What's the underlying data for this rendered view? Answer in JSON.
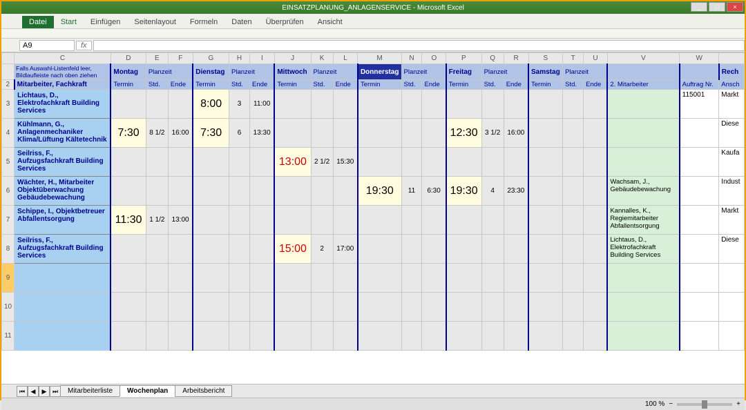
{
  "window": {
    "title": "EINSATZPLANUNG_ANLAGENSERVICE - Microsoft Excel",
    "min": "_",
    "max": "□",
    "close": "×"
  },
  "ribbon": {
    "tabs": [
      "Datei",
      "Start",
      "Einfügen",
      "Seitenlayout",
      "Formeln",
      "Daten",
      "Überprüfen",
      "Ansicht"
    ]
  },
  "formula": {
    "name_box": "A9",
    "fx": "fx"
  },
  "cols": [
    "C",
    "D",
    "E",
    "F",
    "G",
    "H",
    "I",
    "J",
    "K",
    "L",
    "M",
    "N",
    "O",
    "P",
    "Q",
    "R",
    "S",
    "T",
    "U",
    "V",
    "W"
  ],
  "row_nums": [
    "2",
    "3",
    "4",
    "5",
    "6",
    "7",
    "8",
    "9",
    "10",
    "11"
  ],
  "note": "Falls Auswahl-Listenfeld leer, Bildlaufleiste nach oben ziehen",
  "days": [
    "Montag",
    "Dienstag",
    "Mittwoch",
    "Donnerstag",
    "Freitag",
    "Samstag"
  ],
  "planzeit": "Planzeit",
  "subhdr": {
    "mit": "Mitarbeiter, Fachkraft",
    "termin": "Termin",
    "std": "Std.",
    "ende": "Ende",
    "mit2": "2. Mitarbeiter",
    "auftrag": "Auftrag Nr.",
    "ansch": "Ansch",
    "rech": "Rech"
  },
  "rows": [
    {
      "emp": "Lichtaus, D., Elektrofachkraft Building Services",
      "mo": {
        "t": "",
        "s": "",
        "e": ""
      },
      "di": {
        "t": "8:00",
        "s": "3",
        "e": "11:00"
      },
      "mi": {
        "t": "",
        "s": "",
        "e": ""
      },
      "do": {
        "t": "",
        "s": "",
        "e": ""
      },
      "fr": {
        "t": "",
        "s": "",
        "e": ""
      },
      "sa": {
        "t": "",
        "s": "",
        "e": ""
      },
      "mit2": "",
      "auftrag": "115001",
      "an": "Markt"
    },
    {
      "emp": "Kühlmann, G., Anlagenmechaniker Klima/Lüftung Kältetechnik",
      "mo": {
        "t": "7:30",
        "s": "8 1/2",
        "e": "16:00"
      },
      "di": {
        "t": "7:30",
        "s": "6",
        "e": "13:30"
      },
      "mi": {
        "t": "",
        "s": "",
        "e": ""
      },
      "do": {
        "t": "",
        "s": "",
        "e": ""
      },
      "fr": {
        "t": "12:30",
        "s": "3 1/2",
        "e": "16:00"
      },
      "sa": {
        "t": "",
        "s": "",
        "e": ""
      },
      "mit2": "",
      "auftrag": "",
      "an": "Diese"
    },
    {
      "emp": "Seilriss, F., Aufzugsfachkraft Building Services",
      "mo": {
        "t": "",
        "s": "",
        "e": ""
      },
      "di": {
        "t": "",
        "s": "",
        "e": ""
      },
      "mi": {
        "t": "13:00",
        "s": "2 1/2",
        "e": "15:30",
        "red": true
      },
      "do": {
        "t": "",
        "s": "",
        "e": ""
      },
      "fr": {
        "t": "",
        "s": "",
        "e": ""
      },
      "sa": {
        "t": "",
        "s": "",
        "e": ""
      },
      "mit2": "",
      "auftrag": "",
      "an": "Kaufa"
    },
    {
      "emp": "Wächter, H., Mitarbeiter Objektüberwachung Gebäudebewachung",
      "mo": {
        "t": "",
        "s": "",
        "e": ""
      },
      "di": {
        "t": "",
        "s": "",
        "e": ""
      },
      "mi": {
        "t": "",
        "s": "",
        "e": ""
      },
      "do": {
        "t": "19:30",
        "s": "11",
        "e": "6:30"
      },
      "fr": {
        "t": "19:30",
        "s": "4",
        "e": "23:30"
      },
      "sa": {
        "t": "",
        "s": "",
        "e": ""
      },
      "mit2": "Wachsam, J., Gebäudebewachung",
      "auftrag": "",
      "an": "Indust"
    },
    {
      "emp": "Schippe, I., Objektbetreuer Abfallentsorgung",
      "mo": {
        "t": "11:30",
        "s": "1 1/2",
        "e": "13:00"
      },
      "di": {
        "t": "",
        "s": "",
        "e": ""
      },
      "mi": {
        "t": "",
        "s": "",
        "e": ""
      },
      "do": {
        "t": "",
        "s": "",
        "e": ""
      },
      "fr": {
        "t": "",
        "s": "",
        "e": ""
      },
      "sa": {
        "t": "",
        "s": "",
        "e": ""
      },
      "mit2": "Kannalles, K., Regiemitarbeiter Abfallentsorgung",
      "auftrag": "",
      "an": "Markt"
    },
    {
      "emp": "Seilriss, F., Aufzugsfachkraft Building Services",
      "mo": {
        "t": "",
        "s": "",
        "e": ""
      },
      "di": {
        "t": "",
        "s": "",
        "e": ""
      },
      "mi": {
        "t": "15:00",
        "s": "2",
        "e": "17:00",
        "red": true
      },
      "do": {
        "t": "",
        "s": "",
        "e": ""
      },
      "fr": {
        "t": "",
        "s": "",
        "e": ""
      },
      "sa": {
        "t": "",
        "s": "",
        "e": ""
      },
      "mit2": "Lichtaus, D., Elektrofachkraft Building Services",
      "auftrag": "",
      "an": "Diese"
    }
  ],
  "sheets": [
    "Mitarbeiterliste",
    "Wochenplan",
    "Arbeitsbericht"
  ],
  "status": {
    "zoom": "100 %"
  }
}
